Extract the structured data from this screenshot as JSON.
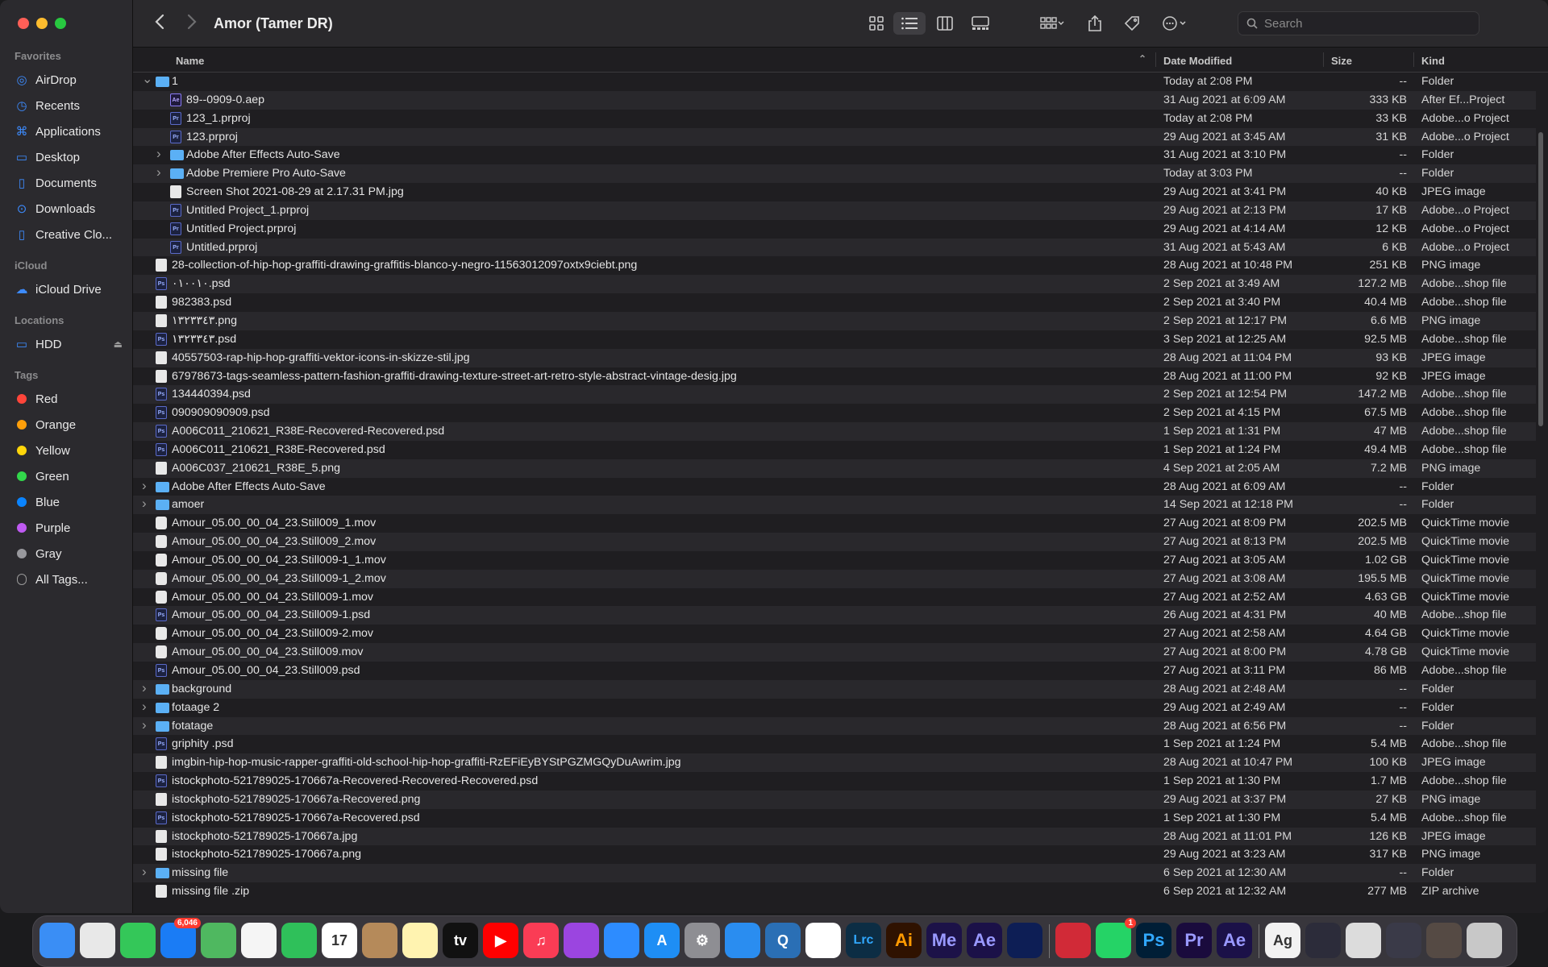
{
  "window": {
    "title": "Amor (Tamer DR)"
  },
  "sidebar": {
    "favorites_label": "Favorites",
    "favorites": [
      {
        "label": "AirDrop",
        "icon": "airdrop-icon"
      },
      {
        "label": "Recents",
        "icon": "clock-icon"
      },
      {
        "label": "Applications",
        "icon": "applications-icon"
      },
      {
        "label": "Desktop",
        "icon": "desktop-icon"
      },
      {
        "label": "Documents",
        "icon": "document-icon"
      },
      {
        "label": "Downloads",
        "icon": "download-icon"
      },
      {
        "label": "Creative Clo...",
        "icon": "file-icon"
      }
    ],
    "icloud_label": "iCloud",
    "icloud": [
      {
        "label": "iCloud Drive",
        "icon": "cloud-icon"
      }
    ],
    "locations_label": "Locations",
    "locations": [
      {
        "label": "HDD",
        "icon": "drive-icon"
      }
    ],
    "tags_label": "Tags",
    "tags": [
      {
        "label": "Red",
        "color": "#fe453a"
      },
      {
        "label": "Orange",
        "color": "#ff9f0a"
      },
      {
        "label": "Yellow",
        "color": "#ffd60a"
      },
      {
        "label": "Green",
        "color": "#32d74b"
      },
      {
        "label": "Blue",
        "color": "#0a84ff"
      },
      {
        "label": "Purple",
        "color": "#bf5af2"
      },
      {
        "label": "Gray",
        "color": "#98989d"
      },
      {
        "label": "All Tags...",
        "color": ""
      }
    ]
  },
  "toolbar": {
    "search_placeholder": "Search"
  },
  "columns": {
    "name": "Name",
    "date": "Date Modified",
    "size": "Size",
    "kind": "Kind"
  },
  "files": [
    {
      "d": 0,
      "disc": "open",
      "icon": "folder",
      "name": "1",
      "date": "Today at 2:08 PM",
      "size": "--",
      "kind": "Folder"
    },
    {
      "d": 1,
      "disc": "",
      "icon": "ae",
      "name": "89--0909-0.aep",
      "date": "31 Aug 2021 at 6:09 AM",
      "size": "333 KB",
      "kind": "After Ef...Project"
    },
    {
      "d": 1,
      "disc": "",
      "icon": "doc",
      "name": "123_1.prproj",
      "date": "Today at 2:08 PM",
      "size": "33 KB",
      "kind": "Adobe...o Project"
    },
    {
      "d": 1,
      "disc": "",
      "icon": "doc",
      "name": "123.prproj",
      "date": "29 Aug 2021 at 3:45 AM",
      "size": "31 KB",
      "kind": "Adobe...o Project"
    },
    {
      "d": 1,
      "disc": "closed",
      "icon": "folder",
      "name": "Adobe After Effects Auto-Save",
      "date": "31 Aug 2021 at 3:10 PM",
      "size": "--",
      "kind": "Folder"
    },
    {
      "d": 1,
      "disc": "closed",
      "icon": "folder",
      "name": "Adobe Premiere Pro Auto-Save",
      "date": "Today at 3:03 PM",
      "size": "--",
      "kind": "Folder"
    },
    {
      "d": 1,
      "disc": "",
      "icon": "img",
      "name": "Screen Shot 2021-08-29 at 2.17.31 PM.jpg",
      "date": "29 Aug 2021 at 3:41 PM",
      "size": "40 KB",
      "kind": "JPEG image"
    },
    {
      "d": 1,
      "disc": "",
      "icon": "doc",
      "name": "Untitled Project_1.prproj",
      "date": "29 Aug 2021 at 2:13 PM",
      "size": "17 KB",
      "kind": "Adobe...o Project"
    },
    {
      "d": 1,
      "disc": "",
      "icon": "doc",
      "name": "Untitled Project.prproj",
      "date": "29 Aug 2021 at 4:14 AM",
      "size": "12 KB",
      "kind": "Adobe...o Project"
    },
    {
      "d": 1,
      "disc": "",
      "icon": "doc",
      "name": "Untitled.prproj",
      "date": "31 Aug 2021 at 5:43 AM",
      "size": "6 KB",
      "kind": "Adobe...o Project"
    },
    {
      "d": 0,
      "disc": "",
      "icon": "img",
      "name": "28-collection-of-hip-hop-graffiti-drawing-graffitis-blanco-y-negro-11563012097oxtx9ciebt.png",
      "date": "28 Aug 2021 at 10:48 PM",
      "size": "251 KB",
      "kind": "PNG image"
    },
    {
      "d": 0,
      "disc": "",
      "icon": "doc",
      "name": "٠١٠٠١٠.psd",
      "date": "2 Sep 2021 at 3:49 AM",
      "size": "127.2 MB",
      "kind": "Adobe...shop file"
    },
    {
      "d": 0,
      "disc": "",
      "icon": "img",
      "name": "982383.psd",
      "date": "2 Sep 2021 at 3:40 PM",
      "size": "40.4 MB",
      "kind": "Adobe...shop file"
    },
    {
      "d": 0,
      "disc": "",
      "icon": "img",
      "name": "١٣٢٣٣٤٣.png",
      "date": "2 Sep 2021 at 12:17 PM",
      "size": "6.6 MB",
      "kind": "PNG image"
    },
    {
      "d": 0,
      "disc": "",
      "icon": "doc",
      "name": "١٣٢٣٣٤٣.psd",
      "date": "3 Sep 2021 at 12:25 AM",
      "size": "92.5 MB",
      "kind": "Adobe...shop file"
    },
    {
      "d": 0,
      "disc": "",
      "icon": "img",
      "name": "40557503-rap-hip-hop-graffiti-vektor-icons-in-skizze-stil.jpg",
      "date": "28 Aug 2021 at 11:04 PM",
      "size": "93 KB",
      "kind": "JPEG image"
    },
    {
      "d": 0,
      "disc": "",
      "icon": "img",
      "name": "67978673-tags-seamless-pattern-fashion-graffiti-drawing-texture-street-art-retro-style-abstract-vintage-desig.jpg",
      "date": "28 Aug 2021 at 11:00 PM",
      "size": "92 KB",
      "kind": "JPEG image"
    },
    {
      "d": 0,
      "disc": "",
      "icon": "doc",
      "name": "134440394.psd",
      "date": "2 Sep 2021 at 12:54 PM",
      "size": "147.2 MB",
      "kind": "Adobe...shop file"
    },
    {
      "d": 0,
      "disc": "",
      "icon": "doc",
      "name": "090909090909.psd",
      "date": "2 Sep 2021 at 4:15 PM",
      "size": "67.5 MB",
      "kind": "Adobe...shop file"
    },
    {
      "d": 0,
      "disc": "",
      "icon": "doc",
      "name": "A006C011_210621_R38E-Recovered-Recovered.psd",
      "date": "1 Sep 2021 at 1:31 PM",
      "size": "47 MB",
      "kind": "Adobe...shop file"
    },
    {
      "d": 0,
      "disc": "",
      "icon": "doc",
      "name": "A006C011_210621_R38E-Recovered.psd",
      "date": "1 Sep 2021 at 1:24 PM",
      "size": "49.4 MB",
      "kind": "Adobe...shop file"
    },
    {
      "d": 0,
      "disc": "",
      "icon": "img",
      "name": "A006C037_210621_R38E_5.png",
      "date": "4 Sep 2021 at 2:05 AM",
      "size": "7.2 MB",
      "kind": "PNG image"
    },
    {
      "d": 0,
      "disc": "closed",
      "icon": "folder",
      "name": "Adobe After Effects Auto-Save",
      "date": "28 Aug 2021 at 6:09 AM",
      "size": "--",
      "kind": "Folder"
    },
    {
      "d": 0,
      "disc": "closed",
      "icon": "folder",
      "name": "amoer",
      "date": "14 Sep 2021 at 12:18 PM",
      "size": "--",
      "kind": "Folder"
    },
    {
      "d": 0,
      "disc": "",
      "icon": "mov",
      "name": "Amour_05.00_00_04_23.Still009_1.mov",
      "date": "27 Aug 2021 at 8:09 PM",
      "size": "202.5 MB",
      "kind": "QuickTime movie"
    },
    {
      "d": 0,
      "disc": "",
      "icon": "mov",
      "name": "Amour_05.00_00_04_23.Still009_2.mov",
      "date": "27 Aug 2021 at 8:13 PM",
      "size": "202.5 MB",
      "kind": "QuickTime movie"
    },
    {
      "d": 0,
      "disc": "",
      "icon": "mov",
      "name": "Amour_05.00_00_04_23.Still009-1_1.mov",
      "date": "27 Aug 2021 at 3:05 AM",
      "size": "1.02 GB",
      "kind": "QuickTime movie"
    },
    {
      "d": 0,
      "disc": "",
      "icon": "mov",
      "name": "Amour_05.00_00_04_23.Still009-1_2.mov",
      "date": "27 Aug 2021 at 3:08 AM",
      "size": "195.5 MB",
      "kind": "QuickTime movie"
    },
    {
      "d": 0,
      "disc": "",
      "icon": "mov",
      "name": "Amour_05.00_00_04_23.Still009-1.mov",
      "date": "27 Aug 2021 at 2:52 AM",
      "size": "4.63 GB",
      "kind": "QuickTime movie"
    },
    {
      "d": 0,
      "disc": "",
      "icon": "doc",
      "name": "Amour_05.00_00_04_23.Still009-1.psd",
      "date": "26 Aug 2021 at 4:31 PM",
      "size": "40 MB",
      "kind": "Adobe...shop file"
    },
    {
      "d": 0,
      "disc": "",
      "icon": "mov",
      "name": "Amour_05.00_00_04_23.Still009-2.mov",
      "date": "27 Aug 2021 at 2:58 AM",
      "size": "4.64 GB",
      "kind": "QuickTime movie"
    },
    {
      "d": 0,
      "disc": "",
      "icon": "mov",
      "name": "Amour_05.00_00_04_23.Still009.mov",
      "date": "27 Aug 2021 at 8:00 PM",
      "size": "4.78 GB",
      "kind": "QuickTime movie"
    },
    {
      "d": 0,
      "disc": "",
      "icon": "doc",
      "name": "Amour_05.00_00_04_23.Still009.psd",
      "date": "27 Aug 2021 at 3:11 PM",
      "size": "86 MB",
      "kind": "Adobe...shop file"
    },
    {
      "d": 0,
      "disc": "closed",
      "icon": "folder",
      "name": "background",
      "date": "28 Aug 2021 at 2:48 AM",
      "size": "--",
      "kind": "Folder"
    },
    {
      "d": 0,
      "disc": "closed",
      "icon": "folder",
      "name": "fotaage 2",
      "date": "29 Aug 2021 at 2:49 AM",
      "size": "--",
      "kind": "Folder"
    },
    {
      "d": 0,
      "disc": "closed",
      "icon": "folder",
      "name": "fotatage",
      "date": "28 Aug 2021 at 6:56 PM",
      "size": "--",
      "kind": "Folder"
    },
    {
      "d": 0,
      "disc": "",
      "icon": "doc",
      "name": "griphity .psd",
      "date": "1 Sep 2021 at 1:24 PM",
      "size": "5.4 MB",
      "kind": "Adobe...shop file"
    },
    {
      "d": 0,
      "disc": "",
      "icon": "img",
      "name": "imgbin-hip-hop-music-rapper-graffiti-old-school-hip-hop-graffiti-RzEFiEyBYStPGZMGQyDuAwrim.jpg",
      "date": "28 Aug 2021 at 10:47 PM",
      "size": "100 KB",
      "kind": "JPEG image"
    },
    {
      "d": 0,
      "disc": "",
      "icon": "doc",
      "name": "istockphoto-521789025-170667a-Recovered-Recovered-Recovered.psd",
      "date": "1 Sep 2021 at 1:30 PM",
      "size": "1.7 MB",
      "kind": "Adobe...shop file"
    },
    {
      "d": 0,
      "disc": "",
      "icon": "img",
      "name": "istockphoto-521789025-170667a-Recovered.png",
      "date": "29 Aug 2021 at 3:37 PM",
      "size": "27 KB",
      "kind": "PNG image"
    },
    {
      "d": 0,
      "disc": "",
      "icon": "doc",
      "name": "istockphoto-521789025-170667a-Recovered.psd",
      "date": "1 Sep 2021 at 1:30 PM",
      "size": "5.4 MB",
      "kind": "Adobe...shop file"
    },
    {
      "d": 0,
      "disc": "",
      "icon": "img",
      "name": "istockphoto-521789025-170667a.jpg",
      "date": "28 Aug 2021 at 11:01 PM",
      "size": "126 KB",
      "kind": "JPEG image"
    },
    {
      "d": 0,
      "disc": "",
      "icon": "img",
      "name": "istockphoto-521789025-170667a.png",
      "date": "29 Aug 2021 at 3:23 AM",
      "size": "317 KB",
      "kind": "PNG image"
    },
    {
      "d": 0,
      "disc": "closed",
      "icon": "folder",
      "name": "missing file",
      "date": "6 Sep 2021 at 12:30 AM",
      "size": "--",
      "kind": "Folder"
    },
    {
      "d": 0,
      "disc": "",
      "icon": "zip",
      "name": "missing file .zip",
      "date": "6 Sep 2021 at 12:32 AM",
      "size": "277 MB",
      "kind": "ZIP archive"
    }
  ],
  "dock": [
    {
      "name": "finder",
      "label": "",
      "color": "#3a8ef5",
      "badge": ""
    },
    {
      "name": "launchpad",
      "label": "",
      "color": "#e8e8e8",
      "badge": ""
    },
    {
      "name": "messages",
      "label": "",
      "color": "#34c759",
      "badge": ""
    },
    {
      "name": "mail",
      "label": "",
      "color": "#1a7cf5",
      "badge": "6,046"
    },
    {
      "name": "maps",
      "label": "",
      "color": "#4fb860",
      "badge": ""
    },
    {
      "name": "photos",
      "label": "",
      "color": "#f5f5f5",
      "badge": ""
    },
    {
      "name": "facetime",
      "label": "",
      "color": "#2fc05a",
      "badge": ""
    },
    {
      "name": "calendar",
      "label": "17",
      "color": "#ffffff",
      "badge": ""
    },
    {
      "name": "contacts",
      "label": "",
      "color": "#b58a5a",
      "badge": ""
    },
    {
      "name": "notes",
      "label": "",
      "color": "#fff3b0",
      "badge": ""
    },
    {
      "name": "tv",
      "label": "tv",
      "color": "#111111",
      "badge": ""
    },
    {
      "name": "youtube",
      "label": "▶",
      "color": "#ff0000",
      "badge": ""
    },
    {
      "name": "music",
      "label": "♫",
      "color": "#fa3c55",
      "badge": ""
    },
    {
      "name": "podcasts",
      "label": "",
      "color": "#9b45e0",
      "badge": ""
    },
    {
      "name": "zoom",
      "label": "",
      "color": "#2d8cff",
      "badge": ""
    },
    {
      "name": "app-store",
      "label": "A",
      "color": "#1e8ef5",
      "badge": ""
    },
    {
      "name": "system-preferences",
      "label": "⚙",
      "color": "#8e8e93",
      "badge": ""
    },
    {
      "name": "safari",
      "label": "",
      "color": "#2a8df0",
      "badge": ""
    },
    {
      "name": "quicktime",
      "label": "Q",
      "color": "#2a6fb5",
      "badge": ""
    },
    {
      "name": "chrome",
      "label": "",
      "color": "#ffffff",
      "badge": ""
    },
    {
      "name": "lightroom-classic",
      "label": "Lrc",
      "color": "#0c2d44",
      "badge": ""
    },
    {
      "name": "illustrator",
      "label": "Ai",
      "color": "#2f1200",
      "badge": ""
    },
    {
      "name": "media-encoder",
      "label": "Me",
      "color": "#1c1248",
      "badge": ""
    },
    {
      "name": "after-effects",
      "label": "Ae",
      "color": "#1b1148",
      "badge": ""
    },
    {
      "name": "cinema-4d",
      "label": "",
      "color": "#0d1e55",
      "badge": ""
    },
    {
      "name": "creative-cloud",
      "label": "",
      "color": "#d12a37",
      "badge": ""
    },
    {
      "name": "whatsapp",
      "label": "",
      "color": "#25d366",
      "badge": "1"
    },
    {
      "name": "photoshop",
      "label": "Ps",
      "color": "#001e36",
      "badge": ""
    },
    {
      "name": "premiere-pro",
      "label": "Pr",
      "color": "#1a0b3d",
      "badge": ""
    },
    {
      "name": "after-effects-2",
      "label": "Ae",
      "color": "#1b1148",
      "badge": ""
    },
    {
      "name": "font-book",
      "label": "Ag",
      "color": "#f2f2f2",
      "badge": ""
    },
    {
      "name": "minimized-window-1",
      "label": "",
      "color": "#2c2c3a",
      "badge": ""
    },
    {
      "name": "minimized-window-2",
      "label": "",
      "color": "#dcdcdc",
      "badge": ""
    },
    {
      "name": "minimized-window-3",
      "label": "",
      "color": "#3a3a48",
      "badge": ""
    },
    {
      "name": "minimized-window-4",
      "label": "",
      "color": "#554a44",
      "badge": ""
    },
    {
      "name": "trash",
      "label": "",
      "color": "#c8c8c8",
      "badge": ""
    }
  ]
}
